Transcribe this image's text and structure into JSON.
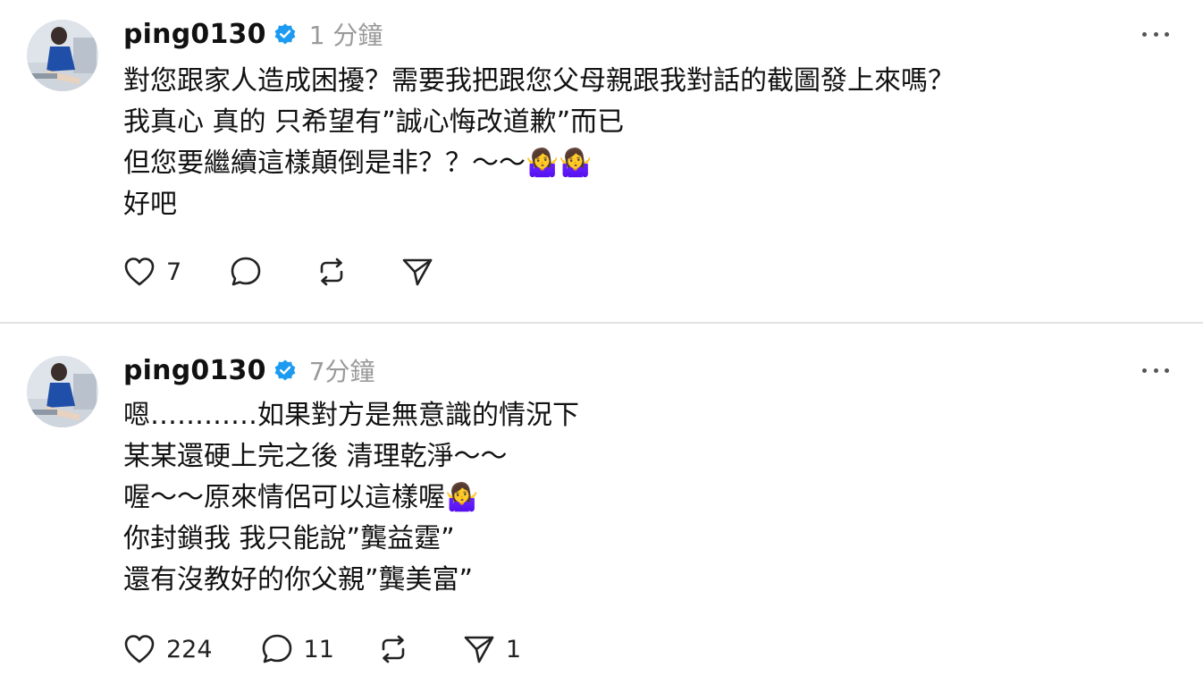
{
  "posts": [
    {
      "username": "ping0130",
      "timestamp": "1 分鐘",
      "lines": [
        "對您跟家人造成困擾？需要我把跟您父母親跟我對話的截圖發上來嗎？",
        "我真心 真的 只希望有”誠心悔改道歉”而已",
        "但您要繼續這樣顛倒是非？？～～🤷‍♀️🤷‍♀️",
        "好吧"
      ],
      "likes": "7",
      "comments": "",
      "reposts": "",
      "shares": ""
    },
    {
      "username": "ping0130",
      "timestamp": "7分鐘",
      "lines": [
        "嗯…………如果對方是無意識的情況下",
        "某某還硬上完之後 清理乾淨～～",
        "喔～～原來情侶可以這樣喔🤷‍♀️",
        "你封鎖我 我只能說”龔益霆”",
        "還有沒教好的你父親”龔美富”"
      ],
      "likes": "224",
      "comments": "11",
      "reposts": "",
      "shares": "1"
    }
  ],
  "colors": {
    "verified": "#1d9bf0",
    "timestamp": "#9a9a9a",
    "divider": "#e2e2e2"
  },
  "icons": [
    "heart-icon",
    "comment-icon",
    "repost-icon",
    "share-icon",
    "verified-icon",
    "more-icon"
  ]
}
